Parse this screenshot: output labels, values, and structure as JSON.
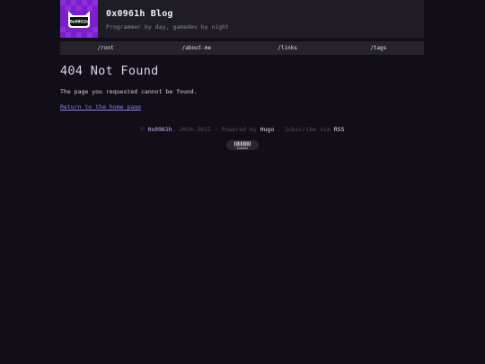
{
  "header": {
    "site_title": "0x0961h Blog",
    "site_subtitle": "Programmer by day, gamedev by night",
    "logo_icon": "cat-mask-logo-icon",
    "logo_text": "0x0961h",
    "accent_color": "#7a1fc9"
  },
  "nav": {
    "items": [
      {
        "label": "/root"
      },
      {
        "label": "/about-me"
      },
      {
        "label": "/links"
      },
      {
        "label": "/tags"
      }
    ]
  },
  "main": {
    "heading": "404 Not Found",
    "message": "The page you requested cannot be found.",
    "home_link": "Return to the home page"
  },
  "footer": {
    "copyright_symbol": "©",
    "author": "0x0961h",
    "years": ", 2024-2025 · Powered by ",
    "engine": "Hugo",
    "subscribe_text": " · Subscribe via ",
    "rss": "RSS",
    "badge_icon": "barcode-badge-icon",
    "badge_text": "0x0961h"
  }
}
